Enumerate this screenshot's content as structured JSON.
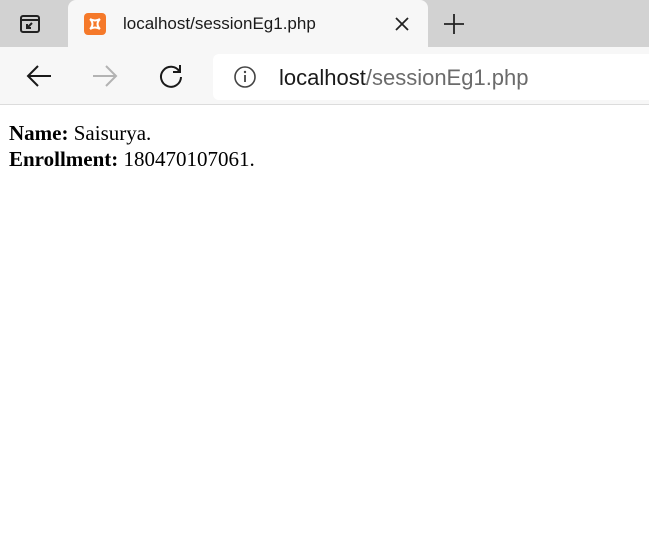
{
  "tab": {
    "title": "localhost/sessionEg1.php",
    "favicon": "xampp-icon"
  },
  "address_bar": {
    "host": "localhost",
    "path": "/sessionEg1.php"
  },
  "toolbar": {
    "back_icon": "back-arrow-icon",
    "forward_icon": "forward-arrow-icon",
    "reload_icon": "reload-icon",
    "site_info_icon": "info-icon"
  },
  "page": {
    "lines": [
      {
        "label": "Name:",
        "value": "Saisurya."
      },
      {
        "label": "Enrollment:",
        "value": "180470107061."
      }
    ]
  },
  "colors": {
    "tabstrip": "#d2d2d2",
    "toolbar": "#f7f7f7",
    "favicon": "#f5792a"
  }
}
